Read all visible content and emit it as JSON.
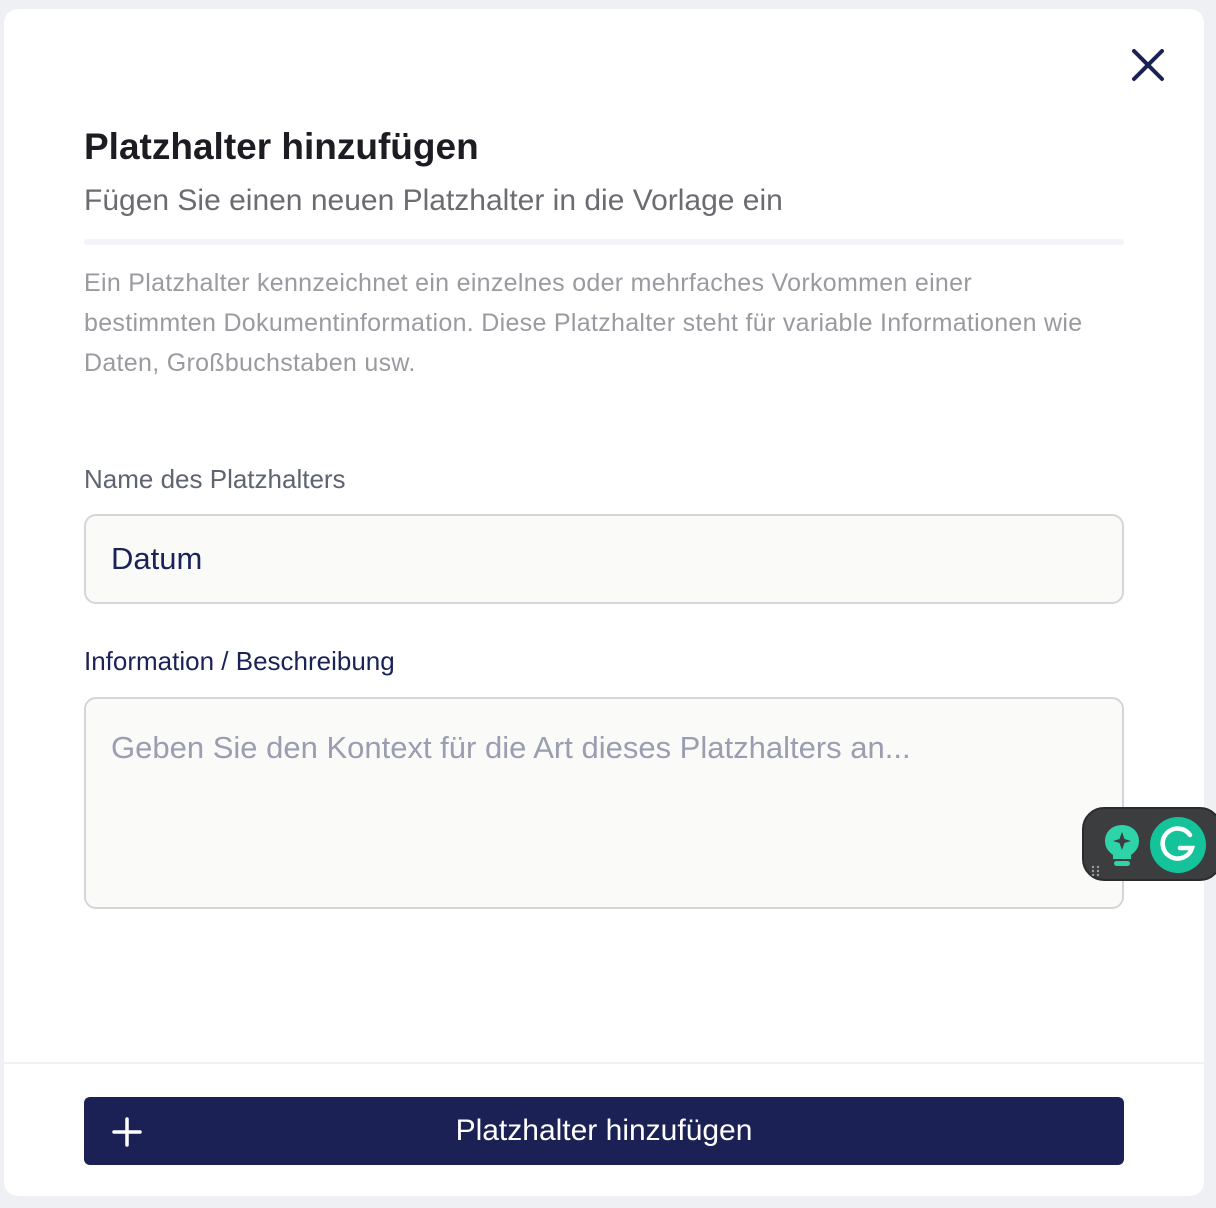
{
  "dialog": {
    "title": "Platzhalter hinzufügen",
    "subtitle": "Fügen Sie einen neuen Platzhalter in die Vorlage ein",
    "description": "Ein Platzhalter kennzeichnet ein einzelnes oder mehrfaches Vorkommen einer bestimmten Dokumentinformation. Diese Platzhalter steht für variable Informationen wie Daten, Großbuchstaben usw.",
    "close_icon": "close-icon"
  },
  "form": {
    "name_label": "Name des Platzhalters",
    "name_value": "Datum",
    "info_label": "Information / Beschreibung",
    "info_placeholder": "Geben Sie den Kontext für die Art dieses Platzhalters an...",
    "info_value": ""
  },
  "footer": {
    "add_button_label": "Platzhalter hinzufügen",
    "add_button_icon": "plus-icon"
  },
  "grammarly_widget": {
    "icons": [
      "bulb-icon",
      "grammarly-logo-icon"
    ]
  },
  "colors": {
    "primary": "#1b2155",
    "title": "#1c1c22",
    "muted_text": "#9a9aa0",
    "input_background": "#fafaf8",
    "grammarly_green": "#15c39a"
  }
}
